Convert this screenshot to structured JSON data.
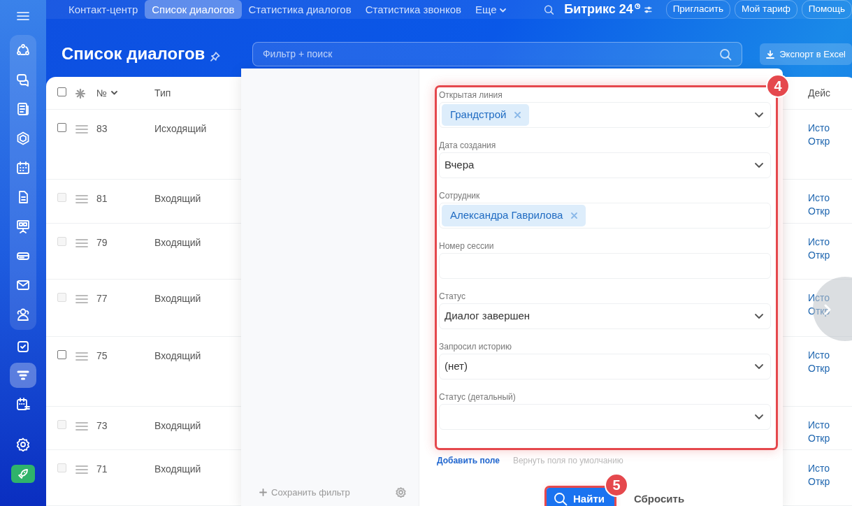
{
  "topbar": {
    "tabs": [
      {
        "label": "Контакт-центр",
        "selected": false,
        "dropdown": false
      },
      {
        "label": "Список диалогов",
        "selected": true,
        "dropdown": false
      },
      {
        "label": "Статистика диалогов",
        "selected": false,
        "dropdown": false
      },
      {
        "label": "Статистика звонков",
        "selected": false,
        "dropdown": false
      },
      {
        "label": "Еще",
        "selected": false,
        "dropdown": true
      }
    ],
    "logo": {
      "name": "Битрикс",
      "number": "24"
    },
    "buttons": [
      "Пригласить",
      "Мой тариф",
      "Помощь"
    ]
  },
  "sidebar": {
    "items": [
      {
        "selected": false
      },
      {
        "selected": false
      },
      {
        "selected": false
      },
      {
        "selected": false
      },
      {
        "selected": false
      },
      {
        "selected": false
      },
      {
        "selected": false
      },
      {
        "selected": false
      },
      {
        "selected": false
      },
      {
        "selected": false
      },
      {
        "selected": false
      },
      {
        "selected": true
      },
      {
        "selected": false
      }
    ]
  },
  "page": {
    "title": "Список диалогов",
    "search": {
      "placeholder": "Фильтр + поиск"
    },
    "export_button": "Экспорт в Excel"
  },
  "table": {
    "select_all": {
      "checked": false
    },
    "columns": [
      {
        "label": "№",
        "sort_arrow": true
      },
      {
        "label": "Тип",
        "sort_arrow": false
      },
      {
        "label": "Дейс",
        "sort_arrow": false
      }
    ],
    "rows": [
      {
        "number": "83",
        "type": "Исходящий",
        "disabled": false,
        "actions": [
          "Исто",
          "Откр"
        ]
      },
      {
        "number": "81",
        "type": "Входящий",
        "disabled": true,
        "actions": [
          "Исто",
          "Откр"
        ]
      },
      {
        "number": "79",
        "type": "Входящий",
        "disabled": true,
        "actions": [
          "Исто",
          "Откр"
        ]
      },
      {
        "number": "77",
        "type": "Входящий",
        "disabled": true,
        "actions": [
          "Исто",
          "Откр"
        ]
      },
      {
        "number": "75",
        "type": "Входящий",
        "disabled": false,
        "actions": [
          "Исто",
          "Откр"
        ]
      },
      {
        "number": "73",
        "type": "Входящий",
        "disabled": true,
        "actions": [
          "Исто",
          "Откр"
        ]
      },
      {
        "number": "71",
        "type": "Входящий",
        "disabled": true,
        "actions": [
          "Исто",
          "Откр"
        ]
      }
    ]
  },
  "filter": {
    "save_button": "Сохранить фильтр",
    "fields": [
      {
        "label": "Открытая линия",
        "kind": "tags",
        "tags": [
          "Грандстрой"
        ],
        "dropdown": true
      },
      {
        "label": "Дата создания",
        "kind": "select",
        "value": "Вчера"
      },
      {
        "label": "Сотрудник",
        "kind": "tags",
        "tags": [
          "Александра Гаврилова"
        ],
        "dropdown": false
      },
      {
        "label": "Номер сессии",
        "kind": "input"
      },
      {
        "label": "Статус",
        "kind": "select",
        "value": "Диалог завершен"
      },
      {
        "label": "Запросил историю",
        "kind": "select",
        "value": "(нет)"
      },
      {
        "label": "Статус (детальный)",
        "kind": "select"
      }
    ],
    "add_field": "Добавить поле",
    "restore_defaults": "Вернуть поля по умолчанию",
    "search_button": "Найти",
    "reset_button": "Сбросить"
  },
  "annotations": [
    {
      "label": "4"
    },
    {
      "label": "5"
    }
  ]
}
